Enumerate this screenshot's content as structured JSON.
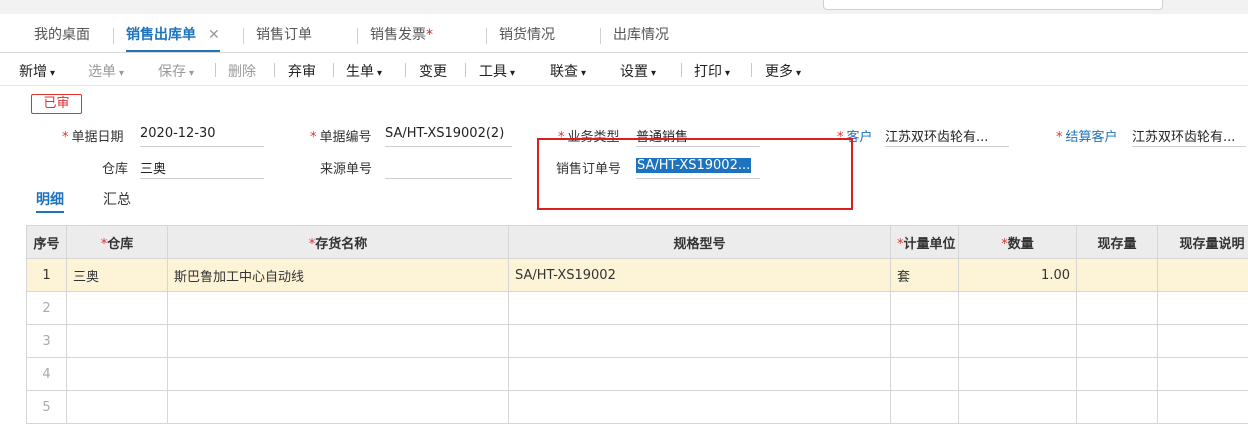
{
  "tabs": [
    {
      "label": "我的桌面"
    },
    {
      "label": "销售出库单",
      "close": "✕"
    },
    {
      "label": "销售订单"
    },
    {
      "label": "销售发票",
      "star": "*"
    },
    {
      "label": "销货情况"
    },
    {
      "label": "出库情况"
    }
  ],
  "toolbar": {
    "add": "新增",
    "select": "选单",
    "save": "保存",
    "delete": "删除",
    "abandon": "弃审",
    "generate": "生单",
    "change": "变更",
    "tools": "工具",
    "link": "联查",
    "settings": "设置",
    "print": "打印",
    "more": "更多",
    "caret": "▾"
  },
  "status_badge": "已审",
  "form": {
    "req_mark": "*",
    "doc_date_label": "单据日期",
    "doc_date": "2020-12-30",
    "doc_no_label": "单据编号",
    "doc_no": "SA/HT-XS19002(2)",
    "biz_type_label": "业务类型",
    "biz_type": "普通销售",
    "customer_label": "客户",
    "customer": "江苏双环齿轮有...",
    "settle_customer_label": "结算客户",
    "settle_customer": "江苏双环齿轮有...",
    "warehouse_label": "仓库",
    "warehouse": "三奥",
    "source_no_label": "来源单号",
    "source_no": "",
    "sales_order_no_label": "销售订单号",
    "sales_order_no": "SA/HT-XS19002..."
  },
  "subtabs": {
    "detail": "明细",
    "summary": "汇总"
  },
  "grid": {
    "headers": {
      "seq": "序号",
      "warehouse": "仓库",
      "item_name": "存货名称",
      "spec": "规格型号",
      "unit": "计量单位",
      "qty": "数量",
      "stock": "现存量",
      "stock_desc": "现存量说明"
    },
    "rows": [
      {
        "seq": "1",
        "warehouse": "三奥",
        "item_name": "斯巴鲁加工中心自动线",
        "spec": "SA/HT-XS19002",
        "unit": "套",
        "qty": "1.00",
        "stock": "",
        "stock_desc": ""
      },
      {
        "seq": "2",
        "warehouse": "",
        "item_name": "",
        "spec": "",
        "unit": "",
        "qty": "",
        "stock": "",
        "stock_desc": ""
      },
      {
        "seq": "3",
        "warehouse": "",
        "item_name": "",
        "spec": "",
        "unit": "",
        "qty": "",
        "stock": "",
        "stock_desc": ""
      },
      {
        "seq": "4",
        "warehouse": "",
        "item_name": "",
        "spec": "",
        "unit": "",
        "qty": "",
        "stock": "",
        "stock_desc": ""
      },
      {
        "seq": "5",
        "warehouse": "",
        "item_name": "",
        "spec": "",
        "unit": "",
        "qty": "",
        "stock": "",
        "stock_desc": ""
      }
    ]
  },
  "colors": {
    "accent": "#1e73be",
    "required": "#e03030",
    "highlight_row": "#fdf4d7",
    "annotation_box": "#d92020"
  }
}
